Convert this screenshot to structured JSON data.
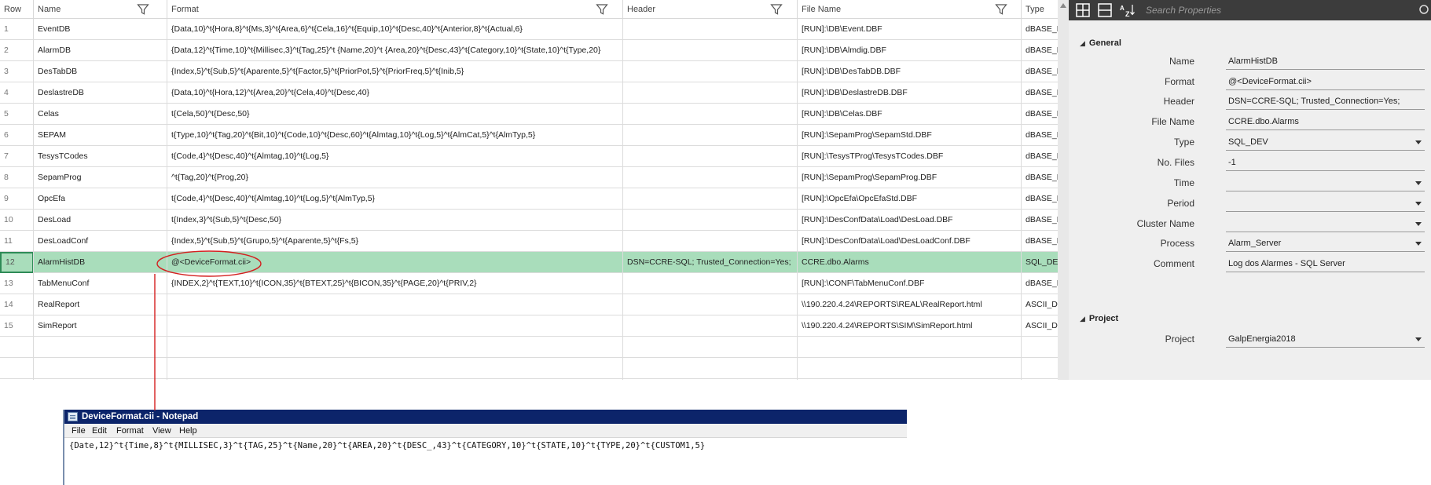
{
  "grid": {
    "columns": [
      {
        "key": "row",
        "label": "Row"
      },
      {
        "key": "name",
        "label": "Name"
      },
      {
        "key": "format",
        "label": "Format"
      },
      {
        "key": "header",
        "label": "Header"
      },
      {
        "key": "file",
        "label": "File Name"
      },
      {
        "key": "type",
        "label": "Type"
      }
    ],
    "selected_row": 12,
    "rows": [
      {
        "row": "1",
        "name": "EventDB",
        "format": "{Data,10}^t{Hora,8}^t{Ms,3}^t{Area,6}^t{Cela,16}^t{Equip,10}^t{Desc,40}^t{Anterior,8}^t{Actual,6}",
        "header": "",
        "file": "[RUN]:\\DB\\Event.DBF",
        "type": "dBASE_D"
      },
      {
        "row": "2",
        "name": "AlarmDB",
        "format": "{Data,12}^t{Time,10}^t{Millisec,3}^t{Tag,25}^t {Name,20}^t {Area,20}^t{Desc,43}^t{Category,10}^t{State,10}^t{Type,20}",
        "header": "",
        "file": "[RUN]:\\DB\\Almdig.DBF",
        "type": "dBASE_D"
      },
      {
        "row": "3",
        "name": "DesTabDB",
        "format": "{Index,5}^t{Sub,5}^t{Aparente,5}^t{Factor,5}^t{PriorPot,5}^t{PriorFreq,5}^t{Inib,5}",
        "header": "",
        "file": "[RUN]:\\DB\\DesTabDB.DBF",
        "type": "dBASE_D"
      },
      {
        "row": "4",
        "name": "DeslastreDB",
        "format": "{Data,10}^t{Hora,12}^t{Area,20}^t{Cela,40}^t{Desc,40}",
        "header": "",
        "file": "[RUN]:\\DB\\DeslastreDB.DBF",
        "type": "dBASE_D"
      },
      {
        "row": "5",
        "name": "Celas",
        "format": "t{Cela,50}^t{Desc,50}",
        "header": "",
        "file": "[RUN]:\\DB\\Celas.DBF",
        "type": "dBASE_D"
      },
      {
        "row": "6",
        "name": "SEPAM",
        "format": "t{Type,10}^t{Tag,20}^t{Bit,10}^t{Code,10}^t{Desc,60}^t{Almtag,10}^t{Log,5}^t{AlmCat,5}^t{AlmTyp,5}",
        "header": "",
        "file": "[RUN]:\\SepamProg\\SepamStd.DBF",
        "type": "dBASE_D"
      },
      {
        "row": "7",
        "name": "TesysTCodes",
        "format": "t{Code,4}^t{Desc,40}^t{Almtag,10}^t{Log,5}",
        "header": "",
        "file": "[RUN]:\\TesysTProg\\TesysTCodes.DBF",
        "type": "dBASE_D"
      },
      {
        "row": "8",
        "name": "SepamProg",
        "format": "^t{Tag,20}^t{Prog,20}",
        "header": "",
        "file": "[RUN]:\\SepamProg\\SepamProg.DBF",
        "type": "dBASE_D"
      },
      {
        "row": "9",
        "name": "OpcEfa",
        "format": "t{Code,4}^t{Desc,40}^t{Almtag,10}^t{Log,5}^t{AlmTyp,5}",
        "header": "",
        "file": "[RUN]:\\OpcEfa\\OpcEfaStd.DBF",
        "type": "dBASE_D"
      },
      {
        "row": "10",
        "name": "DesLoad",
        "format": "t{Index,3}^t{Sub,5}^t{Desc,50}",
        "header": "",
        "file": "[RUN]:\\DesConfData\\Load\\DesLoad.DBF",
        "type": "dBASE_D"
      },
      {
        "row": "11",
        "name": "DesLoadConf",
        "format": "{Index,5}^t{Sub,5}^t{Grupo,5}^t{Aparente,5}^t{Fs,5}",
        "header": "",
        "file": "[RUN]:\\DesConfData\\Load\\DesLoadConf.DBF",
        "type": "dBASE_D"
      },
      {
        "row": "12",
        "name": "AlarmHistDB",
        "format": "@<DeviceFormat.cii>",
        "header": "DSN=CCRE-SQL; Trusted_Connection=Yes;",
        "file": "CCRE.dbo.Alarms",
        "type": "SQL_DEV"
      },
      {
        "row": "13",
        "name": "TabMenuConf",
        "format": "{INDEX,2}^t{TEXT,10}^t{ICON,35}^t{BTEXT,25}^t{BICON,35}^t{PAGE,20}^t{PRIV,2}",
        "header": "",
        "file": "[RUN]:\\CONF\\TabMenuConf.DBF",
        "type": "dBASE_D"
      },
      {
        "row": "14",
        "name": "RealReport",
        "format": "",
        "header": "",
        "file": "\\\\190.220.4.24\\REPORTS\\REAL\\RealReport.html",
        "type": "ASCII_DE"
      },
      {
        "row": "15",
        "name": "SimReport",
        "format": "",
        "header": "",
        "file": "\\\\190.220.4.24\\REPORTS\\SIM\\SimReport.html",
        "type": "ASCII_DE"
      }
    ]
  },
  "properties": {
    "search_placeholder": "Search Properties",
    "sections": {
      "general": "General",
      "project": "Project"
    },
    "fields": [
      {
        "label": "Name",
        "value": "AlarmHistDB",
        "dropdown": false
      },
      {
        "label": "Format",
        "value": "@<DeviceFormat.cii>",
        "dropdown": false
      },
      {
        "label": "Header",
        "value": "DSN=CCRE-SQL; Trusted_Connection=Yes;",
        "dropdown": false
      },
      {
        "label": "File Name",
        "value": "CCRE.dbo.Alarms",
        "dropdown": false
      },
      {
        "label": "Type",
        "value": "SQL_DEV",
        "dropdown": true
      },
      {
        "label": "No. Files",
        "value": "-1",
        "dropdown": false
      },
      {
        "label": "Time",
        "value": "",
        "dropdown": true
      },
      {
        "label": "Period",
        "value": "",
        "dropdown": true
      },
      {
        "label": "Cluster Name",
        "value": "",
        "dropdown": true
      },
      {
        "label": "Process",
        "value": "Alarm_Server",
        "dropdown": true
      },
      {
        "label": "Comment",
        "value": "Log dos Alarmes - SQL Server",
        "dropdown": false
      }
    ],
    "project_field": {
      "label": "Project",
      "value": "GalpEnergia2018",
      "dropdown": true
    }
  },
  "notepad": {
    "title": "DeviceFormat.cii - Notepad",
    "menu": [
      "File",
      "Edit",
      "Format",
      "View",
      "Help"
    ],
    "content": "{Date,12}^t{Time,8}^t{MILLISEC,3}^t{TAG,25}^t{Name,20}^t{AREA,20}^t{DESC_,43}^t{CATEGORY,10}^t{STATE,10}^t{TYPE,20}^t{CUSTOM1,5}"
  },
  "colors": {
    "selected_row": "#a9ddbb",
    "toolbar": "#3c3c3c",
    "panel": "#efefef",
    "notepad_title": "#0c246a",
    "annotation": "#d42020"
  }
}
